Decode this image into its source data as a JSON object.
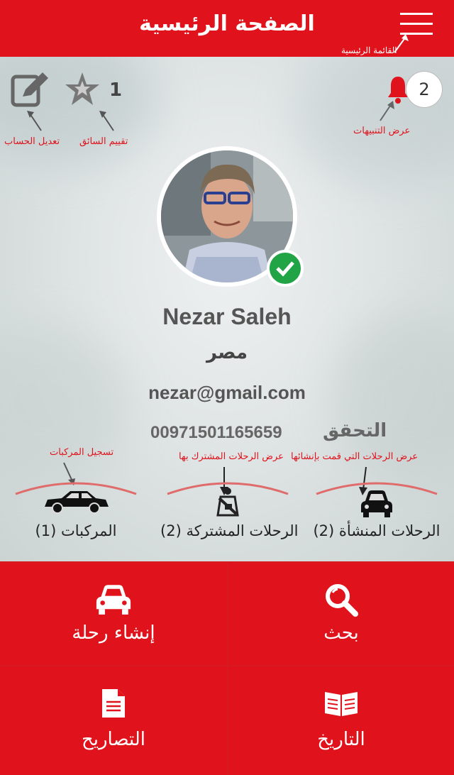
{
  "header": {
    "title": "الصفحة الرئيسية",
    "menu_annotation": "القائمة الرئيسية"
  },
  "top_bar": {
    "notification_count": "2",
    "notifications_annotation": "عرض التنبيهات",
    "rating_value": "1",
    "rating_annotation": "تقييم السائق",
    "edit_annotation": "تعديل الحساب"
  },
  "profile": {
    "name": "Nezar Saleh",
    "country": "مصر",
    "email": "nezar@gmail.com",
    "phone": "00971501165659",
    "verify_label": "التحقق"
  },
  "stats": {
    "vehicles": {
      "label": "المركبات (1)",
      "annotation": "تسجيل المركبات"
    },
    "shared_trips": {
      "label": "الرحلات المشتركة (2)",
      "annotation": "عرض الرحلات المشترك بها"
    },
    "created_trips": {
      "label": "الرحلات المنشأة (2)",
      "annotation": "عرض الرحلات التي قمت بإنشائها"
    }
  },
  "actions": {
    "create_trip": "إنشاء رحلة",
    "search": "بحث",
    "permits": "التصاريح",
    "history": "التاريخ"
  },
  "colors": {
    "brand": "#e0121b",
    "verified": "#20a446"
  }
}
